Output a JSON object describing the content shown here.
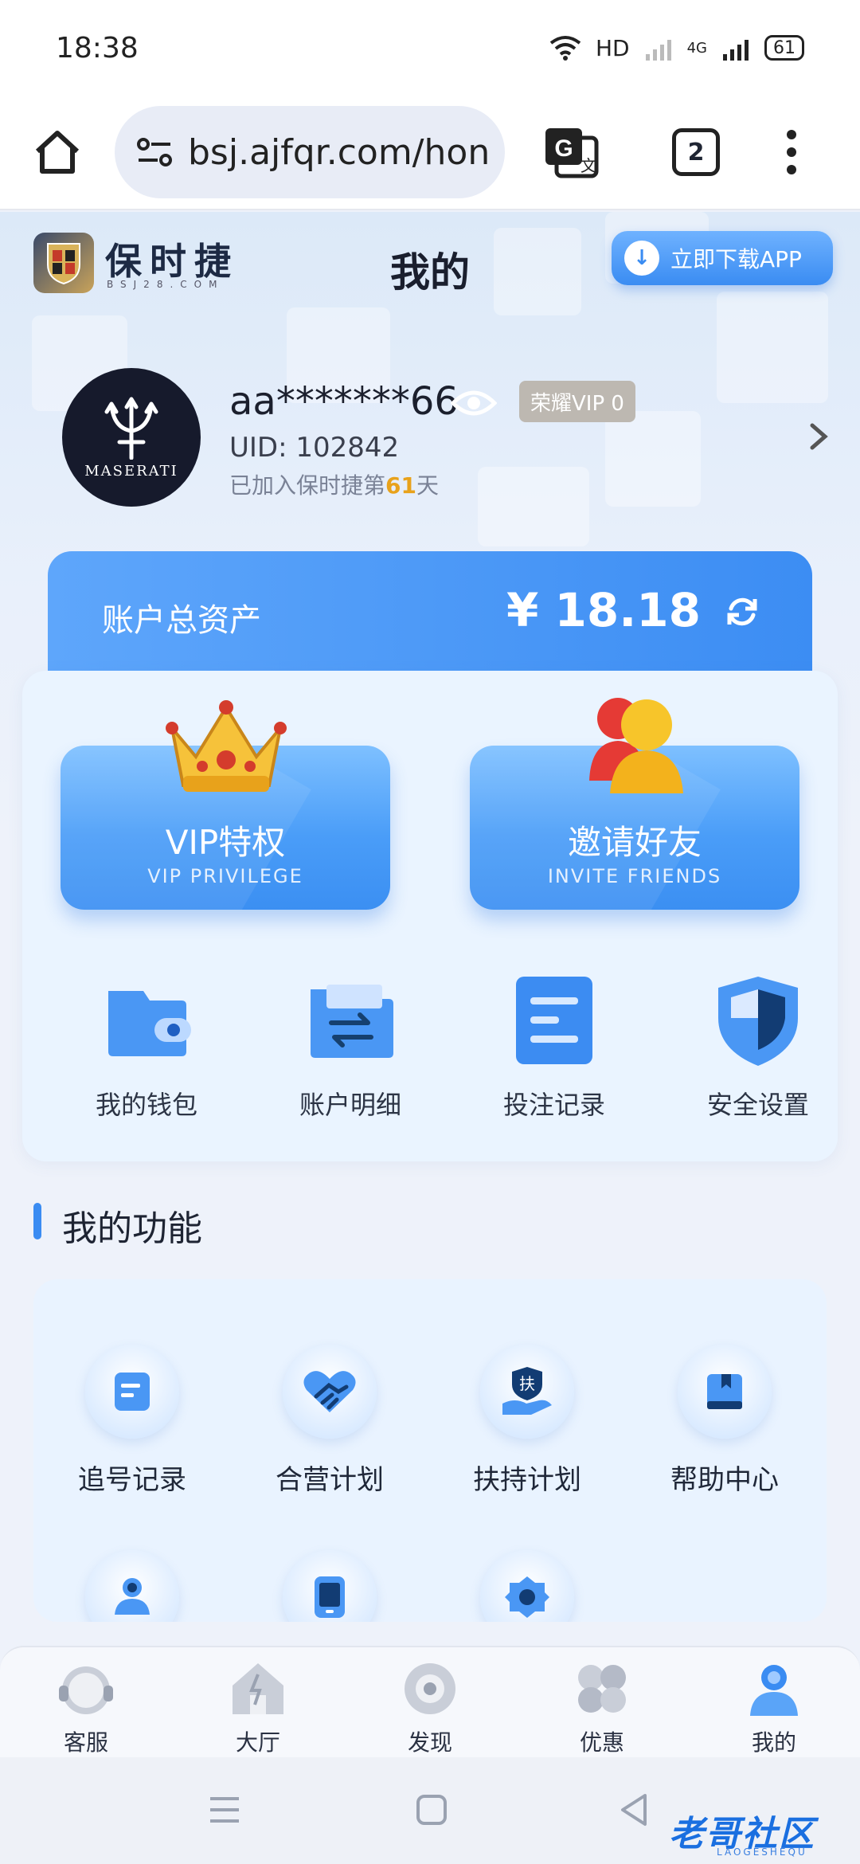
{
  "status_bar": {
    "time": "18:38",
    "network": "HD",
    "signal": "4G",
    "battery": "61"
  },
  "browser": {
    "url": "bsj.ajfqr.com/hon",
    "tab_count": "2"
  },
  "header": {
    "brand_name": "保时捷",
    "brand_sub": "BSJ28.COM",
    "title": "我的",
    "download_label": "立即下载APP"
  },
  "profile": {
    "avatar_text": "MASERATI",
    "username": "aa*******66",
    "vip_badge": "荣耀VIP 0",
    "uid": "UID: 102842",
    "joined_prefix": "已加入保时捷第",
    "joined_days": "61",
    "joined_suffix": "天"
  },
  "assets": {
    "label": "账户总资产",
    "value": "¥ 18.18"
  },
  "promos": [
    {
      "title": "VIP特权",
      "subtitle": "VIP PRIVILEGE",
      "icon": "crown-icon"
    },
    {
      "title": "邀请好友",
      "subtitle": "INVITE FRIENDS",
      "icon": "users-icon"
    }
  ],
  "quick_actions": [
    {
      "label": "我的钱包",
      "icon": "wallet-icon"
    },
    {
      "label": "账户明细",
      "icon": "folder-transfer-icon"
    },
    {
      "label": "投注记录",
      "icon": "record-icon"
    },
    {
      "label": "安全设置",
      "icon": "shield-icon"
    }
  ],
  "section": {
    "title": "我的功能"
  },
  "functions": [
    {
      "label": "追号记录",
      "icon": "document-icon"
    },
    {
      "label": "合营计划",
      "icon": "handshake-icon"
    },
    {
      "label": "扶持计划",
      "icon": "support-icon",
      "glyph": "扶"
    },
    {
      "label": "帮助中心",
      "icon": "book-icon"
    },
    {
      "label": "",
      "icon": "user-group-icon"
    },
    {
      "label": "",
      "icon": "tablet-icon"
    },
    {
      "label": "",
      "icon": "settings-icon"
    }
  ],
  "bottom_nav": [
    {
      "label": "客服",
      "icon": "service-icon"
    },
    {
      "label": "大厅",
      "icon": "hall-icon"
    },
    {
      "label": "发现",
      "icon": "discover-icon"
    },
    {
      "label": "优惠",
      "icon": "offers-icon"
    },
    {
      "label": "我的",
      "icon": "me-icon"
    }
  ],
  "watermark": {
    "text": "老哥社区",
    "sub": "LAOGESHEQU"
  },
  "colors": {
    "accent": "#3a8cf2",
    "highlight": "#e8a21b",
    "badge": "#bdb8b1"
  }
}
